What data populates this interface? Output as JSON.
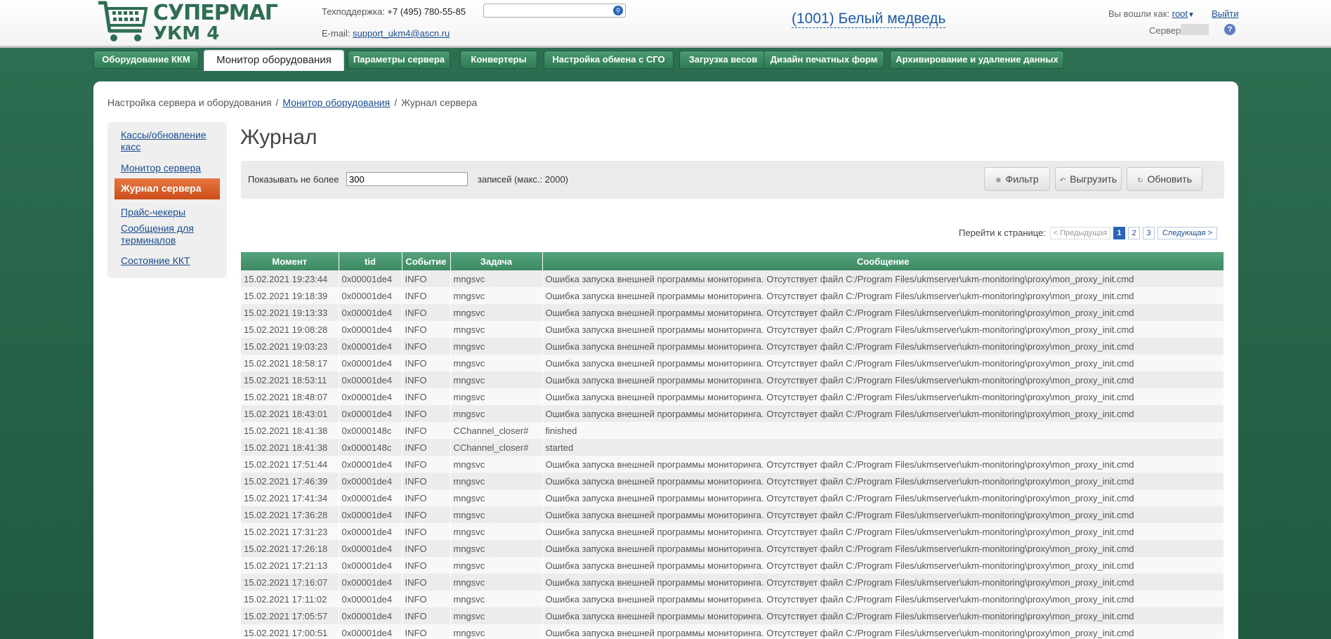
{
  "header": {
    "logo_line1": "СУПЕРМАГ",
    "logo_line2": "УКМ 4",
    "support_label": "Техподдержка: ",
    "support_phone": "+7 (495) 780-55-85",
    "email_label": "E-mail: ",
    "email": "support_ukm4@ascn.ru",
    "search_placeholder": "",
    "store": "(1001) Белый медведь",
    "user_label": "Вы вошли как: ",
    "user_name": "root",
    "logout": "Выйти",
    "server_label": "Сервер",
    "help": "?"
  },
  "topnav": {
    "tabs": [
      {
        "label": "Оборудование ККМ"
      },
      {
        "label": "Монитор оборудования"
      },
      {
        "label": "Параметры сервера"
      },
      {
        "label": "Конвертеры"
      },
      {
        "label": "Настройка обмена с СГО"
      },
      {
        "label": "Загрузка весов"
      },
      {
        "label": "Дизайн печатных форм"
      },
      {
        "label": "Архивирование и удаление данных"
      }
    ],
    "active_index": 1
  },
  "breadcrumb": {
    "items": [
      "Настройка сервера и оборудования",
      "Монитор оборудования",
      "Журнал сервера"
    ],
    "separator": "/"
  },
  "sidebar": {
    "items": [
      {
        "label": "Кассы/обновление касс"
      },
      {
        "label": "Монитор сервера"
      },
      {
        "label": "Журнал сервера"
      },
      {
        "label": "Прайс-чекеры"
      },
      {
        "label": "Сообщения для терминалов"
      },
      {
        "label": "Состояние ККТ"
      }
    ],
    "active_index": 2
  },
  "main": {
    "title": "Журнал",
    "show_label": "Показывать не более",
    "limit_value": "300",
    "records_label": "записей (макс.: 2000)",
    "buttons": {
      "filter": "Фильтр",
      "export": "Выгрузить",
      "refresh": "Обновить"
    },
    "pager": {
      "label": "Перейти к странице:",
      "prev": "< Предыдущая",
      "pages": [
        "1",
        "2",
        "3"
      ],
      "current": "1",
      "next": "Следующая >"
    }
  },
  "table": {
    "columns": [
      "Момент",
      "tid",
      "Событие",
      "Задача",
      "Сообщение"
    ],
    "rows": [
      [
        "15.02.2021 19:23:44",
        "0x00001de4",
        "INFO",
        "mngsvc",
        "Ошибка запуска внешней программы мониторинга. Отсутствует файл C:/Program Files/ukmserver\\ukm-monitoring\\proxy\\mon_proxy_init.cmd"
      ],
      [
        "15.02.2021 19:18:39",
        "0x00001de4",
        "INFO",
        "mngsvc",
        "Ошибка запуска внешней программы мониторинга. Отсутствует файл C:/Program Files/ukmserver\\ukm-monitoring\\proxy\\mon_proxy_init.cmd"
      ],
      [
        "15.02.2021 19:13:33",
        "0x00001de4",
        "INFO",
        "mngsvc",
        "Ошибка запуска внешней программы мониторинга. Отсутствует файл C:/Program Files/ukmserver\\ukm-monitoring\\proxy\\mon_proxy_init.cmd"
      ],
      [
        "15.02.2021 19:08:28",
        "0x00001de4",
        "INFO",
        "mngsvc",
        "Ошибка запуска внешней программы мониторинга. Отсутствует файл C:/Program Files/ukmserver\\ukm-monitoring\\proxy\\mon_proxy_init.cmd"
      ],
      [
        "15.02.2021 19:03:23",
        "0x00001de4",
        "INFO",
        "mngsvc",
        "Ошибка запуска внешней программы мониторинга. Отсутствует файл C:/Program Files/ukmserver\\ukm-monitoring\\proxy\\mon_proxy_init.cmd"
      ],
      [
        "15.02.2021 18:58:17",
        "0x00001de4",
        "INFO",
        "mngsvc",
        "Ошибка запуска внешней программы мониторинга. Отсутствует файл C:/Program Files/ukmserver\\ukm-monitoring\\proxy\\mon_proxy_init.cmd"
      ],
      [
        "15.02.2021 18:53:11",
        "0x00001de4",
        "INFO",
        "mngsvc",
        "Ошибка запуска внешней программы мониторинга. Отсутствует файл C:/Program Files/ukmserver\\ukm-monitoring\\proxy\\mon_proxy_init.cmd"
      ],
      [
        "15.02.2021 18:48:07",
        "0x00001de4",
        "INFO",
        "mngsvc",
        "Ошибка запуска внешней программы мониторинга. Отсутствует файл C:/Program Files/ukmserver\\ukm-monitoring\\proxy\\mon_proxy_init.cmd"
      ],
      [
        "15.02.2021 18:43:01",
        "0x00001de4",
        "INFO",
        "mngsvc",
        "Ошибка запуска внешней программы мониторинга. Отсутствует файл C:/Program Files/ukmserver\\ukm-monitoring\\proxy\\mon_proxy_init.cmd"
      ],
      [
        "15.02.2021 18:41:38",
        "0x0000148c",
        "INFO",
        "CChannel_closer#",
        "finished"
      ],
      [
        "15.02.2021 18:41:38",
        "0x0000148c",
        "INFO",
        "CChannel_closer#",
        "started"
      ],
      [
        "15.02.2021 17:51:44",
        "0x00001de4",
        "INFO",
        "mngsvc",
        "Ошибка запуска внешней программы мониторинга. Отсутствует файл C:/Program Files/ukmserver\\ukm-monitoring\\proxy\\mon_proxy_init.cmd"
      ],
      [
        "15.02.2021 17:46:39",
        "0x00001de4",
        "INFO",
        "mngsvc",
        "Ошибка запуска внешней программы мониторинга. Отсутствует файл C:/Program Files/ukmserver\\ukm-monitoring\\proxy\\mon_proxy_init.cmd"
      ],
      [
        "15.02.2021 17:41:34",
        "0x00001de4",
        "INFO",
        "mngsvc",
        "Ошибка запуска внешней программы мониторинга. Отсутствует файл C:/Program Files/ukmserver\\ukm-monitoring\\proxy\\mon_proxy_init.cmd"
      ],
      [
        "15.02.2021 17:36:28",
        "0x00001de4",
        "INFO",
        "mngsvc",
        "Ошибка запуска внешней программы мониторинга. Отсутствует файл C:/Program Files/ukmserver\\ukm-monitoring\\proxy\\mon_proxy_init.cmd"
      ],
      [
        "15.02.2021 17:31:23",
        "0x00001de4",
        "INFO",
        "mngsvc",
        "Ошибка запуска внешней программы мониторинга. Отсутствует файл C:/Program Files/ukmserver\\ukm-monitoring\\proxy\\mon_proxy_init.cmd"
      ],
      [
        "15.02.2021 17:26:18",
        "0x00001de4",
        "INFO",
        "mngsvc",
        "Ошибка запуска внешней программы мониторинга. Отсутствует файл C:/Program Files/ukmserver\\ukm-monitoring\\proxy\\mon_proxy_init.cmd"
      ],
      [
        "15.02.2021 17:21:13",
        "0x00001de4",
        "INFO",
        "mngsvc",
        "Ошибка запуска внешней программы мониторинга. Отсутствует файл C:/Program Files/ukmserver\\ukm-monitoring\\proxy\\mon_proxy_init.cmd"
      ],
      [
        "15.02.2021 17:16:07",
        "0x00001de4",
        "INFO",
        "mngsvc",
        "Ошибка запуска внешней программы мониторинга. Отсутствует файл C:/Program Files/ukmserver\\ukm-monitoring\\proxy\\mon_proxy_init.cmd"
      ],
      [
        "15.02.2021 17:11:02",
        "0x00001de4",
        "INFO",
        "mngsvc",
        "Ошибка запуска внешней программы мониторинга. Отсутствует файл C:/Program Files/ukmserver\\ukm-monitoring\\proxy\\mon_proxy_init.cmd"
      ],
      [
        "15.02.2021 17:05:57",
        "0x00001de4",
        "INFO",
        "mngsvc",
        "Ошибка запуска внешней программы мониторинга. Отсутствует файл C:/Program Files/ukmserver\\ukm-monitoring\\proxy\\mon_proxy_init.cmd"
      ],
      [
        "15.02.2021 17:00:51",
        "0x00001de4",
        "INFO",
        "mngsvc",
        "Ошибка запуска внешней программы мониторинга. Отсутствует файл C:/Program Files/ukmserver\\ukm-monitoring\\proxy\\mon_proxy_init.cmd"
      ]
    ]
  },
  "colors": {
    "brand_green": "#2f6e52",
    "active_orange": "#e06530",
    "link_blue": "#1a4d8f"
  }
}
